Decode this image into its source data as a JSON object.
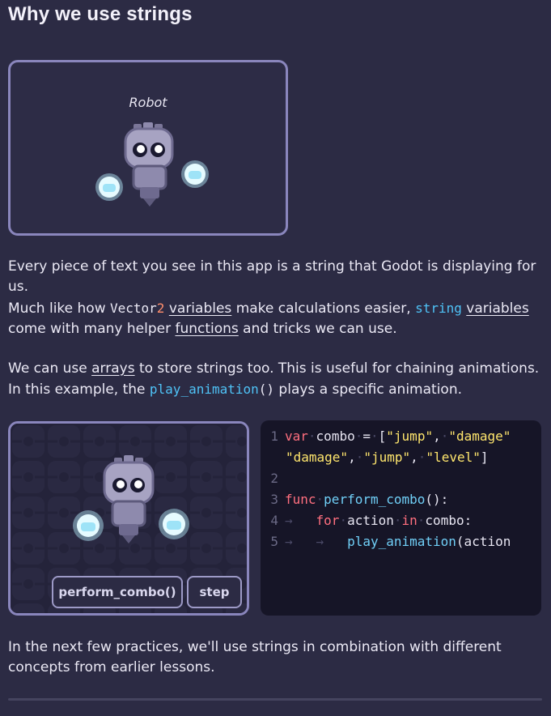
{
  "heading": "Why we use strings",
  "robot_card": {
    "label": "Robot"
  },
  "paragraphs": {
    "p1": "Every piece of text you see in this app is a string that Godot is displaying for us.",
    "p2_a": "Much like how ",
    "p2_vector": "Vector",
    "p2_two": "2",
    "p2_b": " ",
    "p2_variables_link": "variables",
    "p2_c": " make calculations easier, ",
    "p2_string": "string",
    "p2_d": " ",
    "p2_variables_link2": "variables",
    "p2_e": " come with many helper ",
    "p2_functions_link": "functions",
    "p2_f": " and tricks we can use.",
    "p3_a": "We can use ",
    "p3_arrays_link": "arrays",
    "p3_b": " to store strings too. This is useful for chaining animations. In this example, the ",
    "p3_func": "play_animation",
    "p3_parens": "()",
    "p3_c": " plays a specific animation.",
    "p4": "In the next few practices, we'll use strings in combination with different concepts from earlier lessons."
  },
  "demo": {
    "perform_button": "perform_combo()",
    "step_button": "step"
  },
  "code": {
    "line_numbers": [
      "1",
      "2",
      "3",
      "4",
      "5"
    ],
    "l1_kw": "var",
    "l1_name": "combo",
    "l1_eq": "=",
    "l1_open": "[",
    "l1_s1": "\"jump\"",
    "l1_comma": ",",
    "l1_s2": "\"damage\"",
    "l1b_s1": "\"damage\"",
    "l1b_s2": "\"jump\"",
    "l1b_s3": "\"level\"",
    "l1b_close": "]",
    "l3_kw": "func",
    "l3_fn": "perform_combo",
    "l3_rest": "():",
    "l4_kw": "for",
    "l4_var": "action",
    "l4_in": "in",
    "l4_rest": "combo:",
    "l5_fn": "play_animation",
    "l5_rest": "(action"
  },
  "colors": {
    "background": "#2c2b44",
    "card_border": "#8a86bd",
    "code_bg": "#161527",
    "keyword": "#ff6f7f",
    "string": "#ffe66d",
    "function": "#70cff7"
  }
}
